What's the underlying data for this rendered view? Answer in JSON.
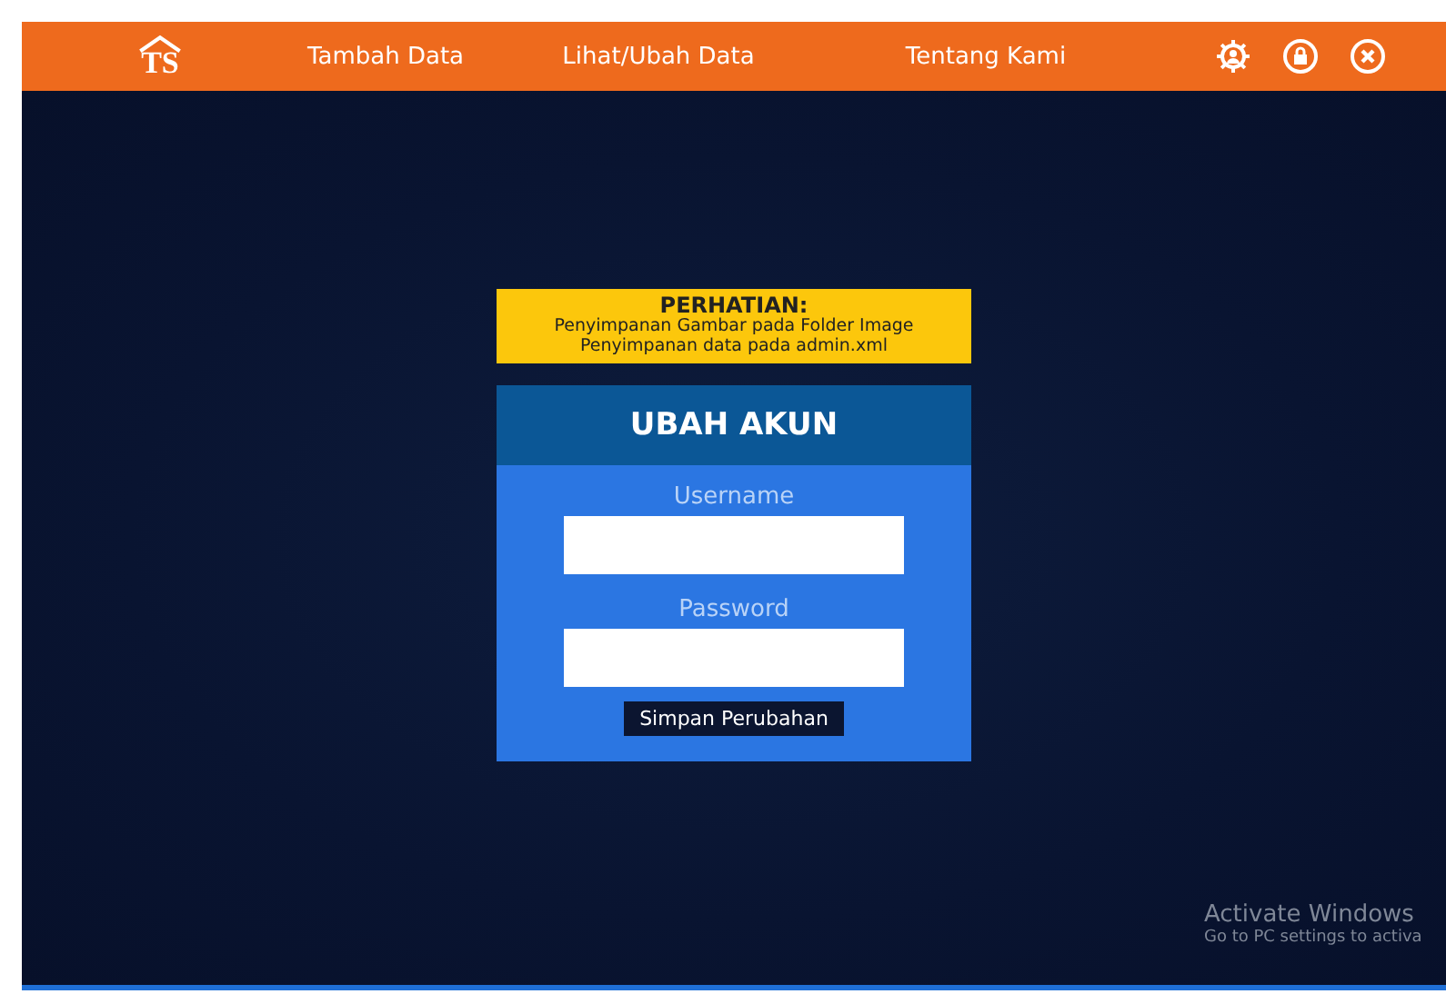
{
  "header": {
    "logo": "TS",
    "nav": [
      {
        "label": "Tambah Data"
      },
      {
        "label": "Lihat/Ubah Data"
      },
      {
        "label": "Tentang Kami"
      }
    ]
  },
  "notice": {
    "title": "PERHATIAN:",
    "lines": [
      "Penyimpanan Gambar pada Folder Image",
      "Penyimpanan data pada admin.xml"
    ]
  },
  "form": {
    "title": "UBAH AKUN",
    "fields": [
      {
        "label": "Username"
      },
      {
        "label": "Password"
      }
    ],
    "button": "Simpan Perubahan"
  },
  "watermark": {
    "title": "Activate Windows",
    "subtitle": "Go to PC settings to activa"
  }
}
